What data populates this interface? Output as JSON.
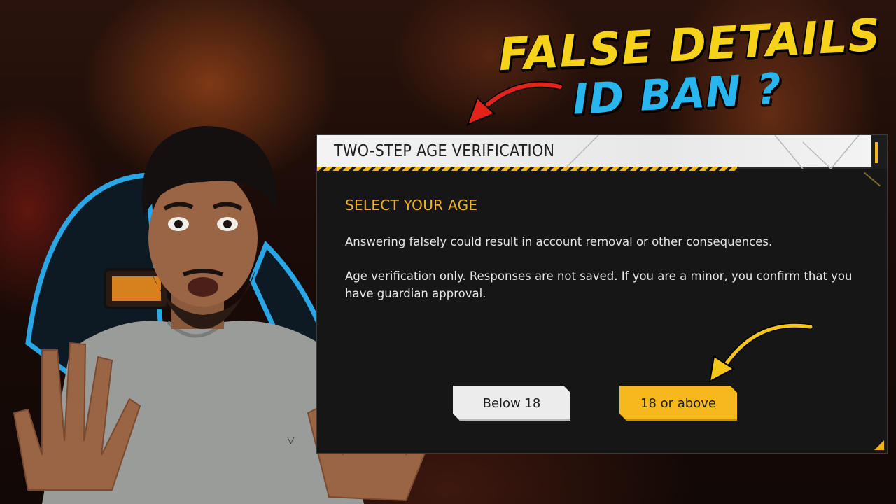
{
  "headline": {
    "line1": "FALSE DETAILS",
    "line2": "ID BAN ?",
    "line1_color": "#f7d21b",
    "line2_color": "#27b7ee"
  },
  "dialog": {
    "title": "TWO-STEP AGE VERIFICATION",
    "section_label": "SELECT YOUR AGE",
    "paragraph1": "Answering falsely could result in account removal or other consequences.",
    "paragraph2": "Age verification only. Responses are not saved. If you are a minor, you confirm that you have guardian approval.",
    "buttons": {
      "below_18": "Below 18",
      "above_18": "18 or above"
    },
    "accent_color": "#f2b31b"
  },
  "arrows": {
    "top_arrow_color": "#e2231a",
    "bottom_arrow_color": "#f5c518"
  },
  "shirt_logo": "▽"
}
